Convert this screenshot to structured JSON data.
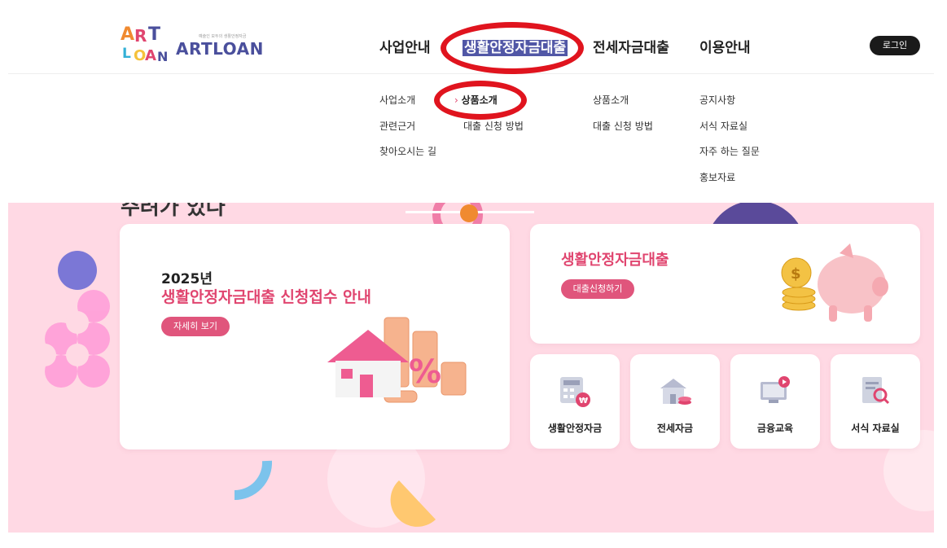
{
  "brand": {
    "name": "ARTLOAN",
    "tagline": "예술인 모두의 생활안정자금",
    "mark_letters": [
      "A",
      "R",
      "T",
      "L",
      "O",
      "A",
      "N"
    ]
  },
  "nav": {
    "items": [
      {
        "label": "사업안내"
      },
      {
        "label": "생활안정자금대출",
        "active": true
      },
      {
        "label": "전세자금대출"
      },
      {
        "label": "이용안내"
      }
    ],
    "login_label": "로그인"
  },
  "dropdown": {
    "business": [
      "사업소개",
      "관련근거",
      "찾아오시는 길"
    ],
    "living_loan": [
      "상품소개",
      "대출 신청 방법"
    ],
    "jeonse_loan": [
      "상품소개",
      "대출 신청 방법"
    ],
    "guide": [
      "공지사항",
      "서식 자료실",
      "자주 하는 질문",
      "홍보자료"
    ],
    "current_item": "상품소개"
  },
  "hero": {
    "partial_heading": "주려가 있다"
  },
  "main_banner": {
    "year": "2025년",
    "title": "생활안정자금대출 신청접수 안내",
    "button": "자세히 보기"
  },
  "loan_card": {
    "title": "생활안정자금대출",
    "button": "대출신청하기"
  },
  "quick_links": [
    {
      "label": "생활안정자금",
      "icon": "calculator-won-icon"
    },
    {
      "label": "전세자금",
      "icon": "house-coin-icon"
    },
    {
      "label": "금융교육",
      "icon": "monitor-play-icon"
    },
    {
      "label": "서식 자료실",
      "icon": "document-search-icon"
    }
  ],
  "colors": {
    "accent_pink": "#e0456f",
    "brand_navy": "#4a4f9c",
    "background_pink": "#ffd9e4",
    "highlight_red": "#e0141e"
  }
}
